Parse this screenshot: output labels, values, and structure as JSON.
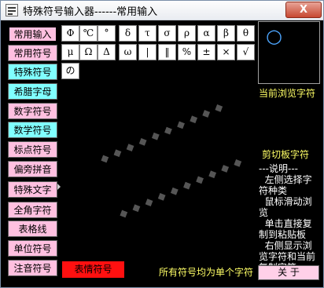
{
  "window": {
    "title": "特殊符号输入器------常用输入",
    "close_label": "X"
  },
  "sidebar": {
    "items": [
      {
        "label": "常用输入",
        "color": "pink"
      },
      {
        "label": "常用符号",
        "color": "pink"
      },
      {
        "label": "特殊符号",
        "color": "cyan"
      },
      {
        "label": "希腊字母",
        "color": "cyan"
      },
      {
        "label": "数字符号",
        "color": "pink"
      },
      {
        "label": "数学符号",
        "color": "cyan"
      },
      {
        "label": "标点符号",
        "color": "pink"
      },
      {
        "label": "偏旁拼音",
        "color": "pink"
      },
      {
        "label": "特殊文字",
        "color": "pink"
      },
      {
        "label": "全角字符",
        "color": "pink"
      },
      {
        "label": "表格线",
        "color": "pink"
      },
      {
        "label": "单位符号",
        "color": "pink"
      },
      {
        "label": "注音符号",
        "color": "pink"
      }
    ],
    "emoticon_label": "表情符号"
  },
  "symbols": {
    "row1": [
      "Φ",
      "℃",
      "°",
      "δ",
      "τ",
      "σ",
      "ρ",
      "α",
      "β",
      "θ"
    ],
    "row2": [
      "μ",
      "Ω",
      "Δ",
      "ω",
      "|",
      "‖",
      "%",
      "±",
      "×",
      "√"
    ],
    "row3": [
      "の"
    ]
  },
  "preview": {
    "glyph": "○",
    "caption": "当前浏览字符"
  },
  "clipboard": {
    "label": "剪切板字符"
  },
  "help": {
    "text": "---说明---\n  左侧选择字符种类\n  鼠标滑动浏览\n  单击直接复制到粘贴板\n  右侧显示浏览字符和当前复制字符"
  },
  "footer": {
    "note": "所有符号均为单个字符",
    "about_label": "关 于"
  },
  "colors": {
    "accent_pink": "#ffc0e0",
    "accent_cyan": "#80ffff",
    "emoticon_red": "#ff1010",
    "text_yellow": "#ffff66"
  }
}
